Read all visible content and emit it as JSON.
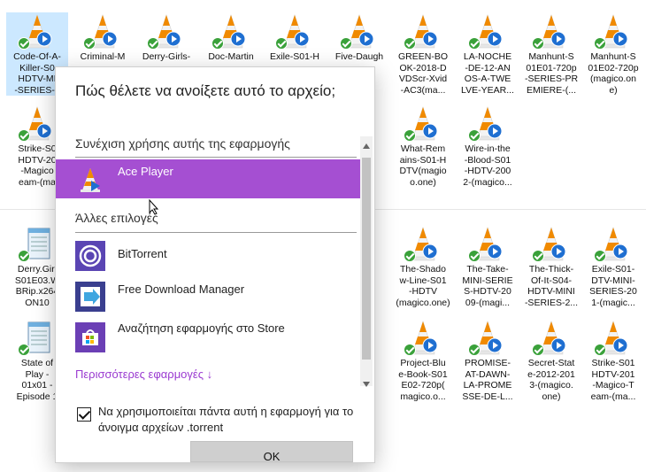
{
  "explorer": {
    "files": [
      {
        "label": "Code-Of-A-\nKiller-S0\nHDTV-MI\n-SERIES-2",
        "type": "vlc",
        "selected": true
      },
      {
        "label": "Criminal-M",
        "type": "vlc"
      },
      {
        "label": "Derry-Girls-",
        "type": "vlc"
      },
      {
        "label": "Doc-Martin",
        "type": "vlc"
      },
      {
        "label": "Exile-S01-H",
        "type": "vlc"
      },
      {
        "label": "Five-Daugh",
        "type": "vlc"
      },
      {
        "label": "GREEN-BO\nOK-2018-D\nVDScr-Xvid\n-AC3(ma...",
        "type": "vlc"
      },
      {
        "label": "LA-NOCHE\n-DE-12-AN\nOS-A-TWE\nLVE-YEAR...",
        "type": "vlc"
      },
      {
        "label": "Manhunt-S\n01E01-720p\n-SERIES-PR\nEMIERE-(...",
        "type": "vlc"
      },
      {
        "label": "Manhunt-S\n01E02-720p\n(magico.on\ne)",
        "type": "vlc"
      },
      {
        "label": "Strike-S0\nHDTV-20\n-Magico\neam-(ma",
        "type": "vlc"
      },
      {
        "label": "d-\ne-",
        "type": "vlc"
      },
      {
        "label": "What-Rem\nains-S01-H\nDTV(magio\no.one)",
        "type": "vlc"
      },
      {
        "label": "Wire-in-the\n-Blood-S01\n-HDTV-200\n2-(magico...",
        "type": "vlc"
      },
      {
        "label": "Derry.Girl\nS01E03.W\nBRip.x264\nON10",
        "type": "notepad"
      },
      {
        "label": "The-Shado\nw-Line-S01\n-HDTV\n(magico.one)",
        "type": "vlc"
      },
      {
        "label": "The-Take-\nMINI-SERIE\nS-HDTV-20\n09-(magi...",
        "type": "vlc"
      },
      {
        "label": "The-Thick-\nOf-It-S04-\nHDTV-MINI\n-SERIES-2...",
        "type": "vlc"
      },
      {
        "label": "Exile-S01-\nDTV-MINI-\nSERIES-20\n1-(magic...",
        "type": "vlc"
      },
      {
        "label": "State of\nPlay -\n01x01 -\nEpisode 1",
        "type": "notepad"
      },
      {
        "label": "Project-Blu\ne-Book-S01\nE02-720p(\nmagico.o...",
        "type": "vlc"
      },
      {
        "label": "PROMISE-\nAT-DAWN-\nLA-PROME\nSSE-DE-L...",
        "type": "vlc"
      },
      {
        "label": "Secret-Stat\ne-2012-201\n3-(magico.\none)",
        "type": "vlc"
      },
      {
        "label": "Strike-S01\nHDTV-201\n-Magico-T\neam-(ma...",
        "type": "vlc"
      }
    ]
  },
  "dialog": {
    "title": "Πώς θέλετε να ανοίξετε αυτό το αρχείο;",
    "keep_using": "Συνέχιση χρήσης αυτής της εφαρμογής",
    "selected_app": "Ace Player",
    "other_options": "Άλλες επιλογές",
    "apps": [
      {
        "name": "BitTorrent",
        "icon": "bittorrent-icon"
      },
      {
        "name": "Free Download Manager",
        "icon": "fdm-icon"
      },
      {
        "name": "Αναζήτηση εφαρμογής στο Store",
        "icon": "store-icon"
      }
    ],
    "more_apps": "Περισσότερες εφαρμογές ↓",
    "always_use": "Να χρησιμοποιείται πάντα αυτή η εφαρμογή για το άνοιγμα αρχείων .torrent",
    "always_use_checked": true,
    "ok": "OK"
  },
  "colors": {
    "accent": "#a54fd2",
    "vlc_orange": "#f08a00",
    "check_green": "#3aa13a"
  }
}
